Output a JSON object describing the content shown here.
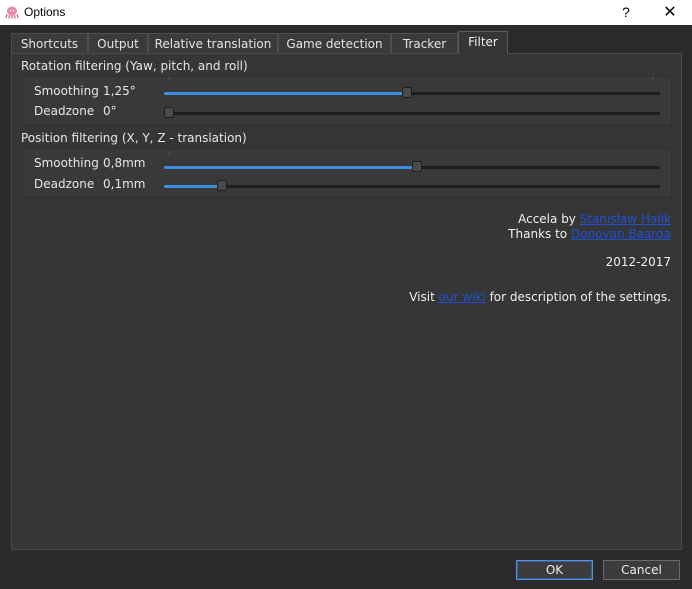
{
  "window": {
    "title": "Options",
    "help_label": "?",
    "close_label": "✕"
  },
  "tabs": [
    {
      "label": "Shortcuts"
    },
    {
      "label": "Output"
    },
    {
      "label": "Relative translation"
    },
    {
      "label": "Game detection"
    },
    {
      "label": "Tracker"
    },
    {
      "label": "Filter",
      "active": true
    }
  ],
  "rotation": {
    "title": "Rotation filtering (Yaw, pitch, and roll)",
    "smoothing": {
      "label": "Smoothing",
      "value": "1,25°",
      "position": 0.49
    },
    "deadzone": {
      "label": "Deadzone",
      "value": "0°",
      "position": 0.0
    }
  },
  "position": {
    "title": "Position filtering (X, Y, Z - translation)",
    "smoothing": {
      "label": "Smoothing",
      "value": "0,8mm",
      "position": 0.51
    },
    "deadzone": {
      "label": "Deadzone",
      "value": "0,1mm",
      "position": 0.11
    }
  },
  "credits": {
    "line1_prefix": "Accela by ",
    "line1_link": "Stanisław Halik",
    "line2_prefix": "Thanks to ",
    "line2_link": "Donovan Baarda",
    "years": "2012-2017",
    "visit_prefix": "Visit ",
    "visit_link": "our wiki",
    "visit_suffix": " for description of the settings."
  },
  "buttons": {
    "ok": "OK",
    "cancel": "Cancel"
  },
  "colors": {
    "accent": "#3d8ee0",
    "link": "#1f4fd8",
    "background": "#2b2b2b"
  }
}
